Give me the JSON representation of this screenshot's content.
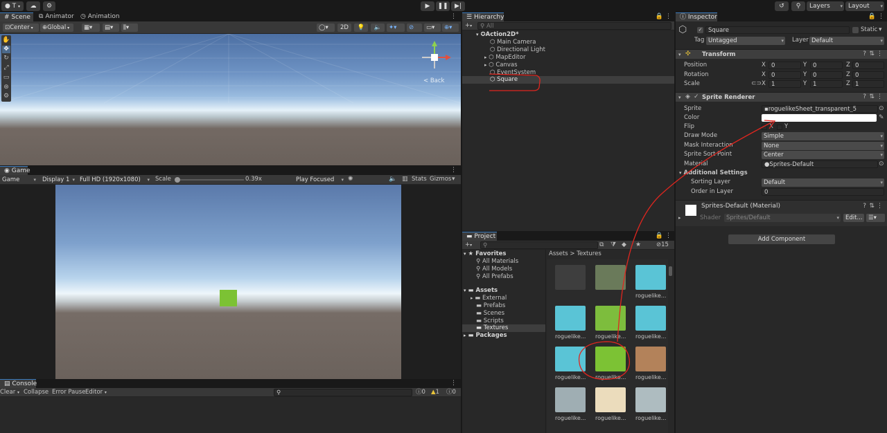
{
  "toolbar": {
    "account_label": "T",
    "layers_label": "Layers",
    "layout_label": "Layout"
  },
  "scene": {
    "tabs": [
      {
        "label": "Scene"
      },
      {
        "label": "Animator"
      },
      {
        "label": "Animation"
      }
    ],
    "pivot_label": "Center",
    "space_label": "Global",
    "mode_2d_label": "2D",
    "gizmo_view_label": "< Back"
  },
  "game": {
    "tab_label": "Game",
    "view_label": "Game",
    "display_label": "Display 1",
    "resolution_label": "Full HD (1920x1080)",
    "scale_label": "Scale",
    "scale_value": "0.39x",
    "scale_fraction": 0.0,
    "play_focus_label": "Play Focused",
    "stats_label": "Stats",
    "gizmos_label": "Gizmos"
  },
  "console": {
    "tab_label": "Console",
    "clear_label": "Clear",
    "collapse_label": "Collapse",
    "error_pause_label": "Error Pause",
    "editor_label": "Editor",
    "count_messages": "0",
    "count_warnings": "1",
    "count_errors": "0"
  },
  "hierarchy": {
    "tab_label": "Hierarchy",
    "search_placeholder": "All",
    "scene_name": "Action2D*",
    "items": [
      {
        "label": "Main Camera"
      },
      {
        "label": "Directional Light"
      },
      {
        "label": "MapEditor"
      },
      {
        "label": "Canvas"
      },
      {
        "label": "EventSystem"
      },
      {
        "label": "Square"
      }
    ]
  },
  "project": {
    "tab_label": "Project",
    "hidden_count": "15",
    "favorites_label": "Favorites",
    "favorites": [
      {
        "label": "All Materials"
      },
      {
        "label": "All Models"
      },
      {
        "label": "All Prefabs"
      }
    ],
    "assets_label": "Assets",
    "folders": [
      {
        "label": "External"
      },
      {
        "label": "Prefabs"
      },
      {
        "label": "Scenes"
      },
      {
        "label": "Scripts"
      },
      {
        "label": "Textures"
      }
    ],
    "packages_label": "Packages",
    "breadcrumb_root": "Assets",
    "breadcrumb_current": "Textures",
    "thumb_rows": [
      [
        {
          "label": "",
          "color": "#3e3e3e"
        },
        {
          "label": "",
          "color": "#6a7a5a"
        },
        {
          "label": "roguelike...",
          "color": "#5ac4d6"
        }
      ],
      [
        {
          "label": "roguelike...",
          "color": "#5ac4d6"
        },
        {
          "label": "roguelike...",
          "color": "#7dbd3d"
        },
        {
          "label": "roguelike...",
          "color": "#5ac4d6"
        }
      ],
      [
        {
          "label": "roguelike...",
          "color": "#5ac4d6"
        },
        {
          "label": "roguelike...",
          "color": "#7cc234"
        },
        {
          "label": "roguelike...",
          "color": "#b3825a"
        }
      ],
      [
        {
          "label": "roguelike...",
          "color": "#9faeb3"
        },
        {
          "label": "roguelike...",
          "color": "#ebdcbc"
        },
        {
          "label": "roguelike...",
          "color": "#aebcc0"
        }
      ]
    ]
  },
  "inspector": {
    "tab_label": "Inspector",
    "object_name": "Square",
    "static_label": "Static",
    "tag_label": "Tag",
    "tag_value": "Untagged",
    "layer_label": "Layer",
    "layer_value": "Default",
    "transform": {
      "title": "Transform",
      "rows": [
        {
          "label": "Position",
          "x": "0",
          "y": "0",
          "z": "0"
        },
        {
          "label": "Rotation",
          "x": "0",
          "y": "0",
          "z": "0"
        },
        {
          "label": "Scale",
          "x": "1",
          "y": "1",
          "z": "1"
        }
      ]
    },
    "sprite_renderer": {
      "title": "Sprite Renderer",
      "sprite_label": "Sprite",
      "sprite_value": "roguelikeSheet_transparent_5",
      "color_label": "Color",
      "color_value": "#ffffff",
      "flip_label": "Flip",
      "flip_x": "X",
      "flip_y": "Y",
      "draw_mode_label": "Draw Mode",
      "draw_mode_value": "Simple",
      "mask_label": "Mask Interaction",
      "mask_value": "None",
      "sort_point_label": "Sprite Sort Point",
      "sort_point_value": "Center",
      "material_label": "Material",
      "material_value": "Sprites-Default",
      "additional_label": "Additional Settings",
      "sorting_layer_label": "Sorting Layer",
      "sorting_layer_value": "Default",
      "order_label": "Order in Layer",
      "order_value": "0"
    },
    "material": {
      "title": "Sprites-Default (Material)",
      "shader_label": "Shader",
      "shader_value": "Sprites/Default",
      "edit_label": "Edit..."
    },
    "add_component_label": "Add Component"
  },
  "colors": {
    "panel_bg": "#282828",
    "selection": "#2c5d87",
    "accent": "#3a79bb",
    "annotation": "#e0261f",
    "sprite_green": "#7cc234"
  }
}
